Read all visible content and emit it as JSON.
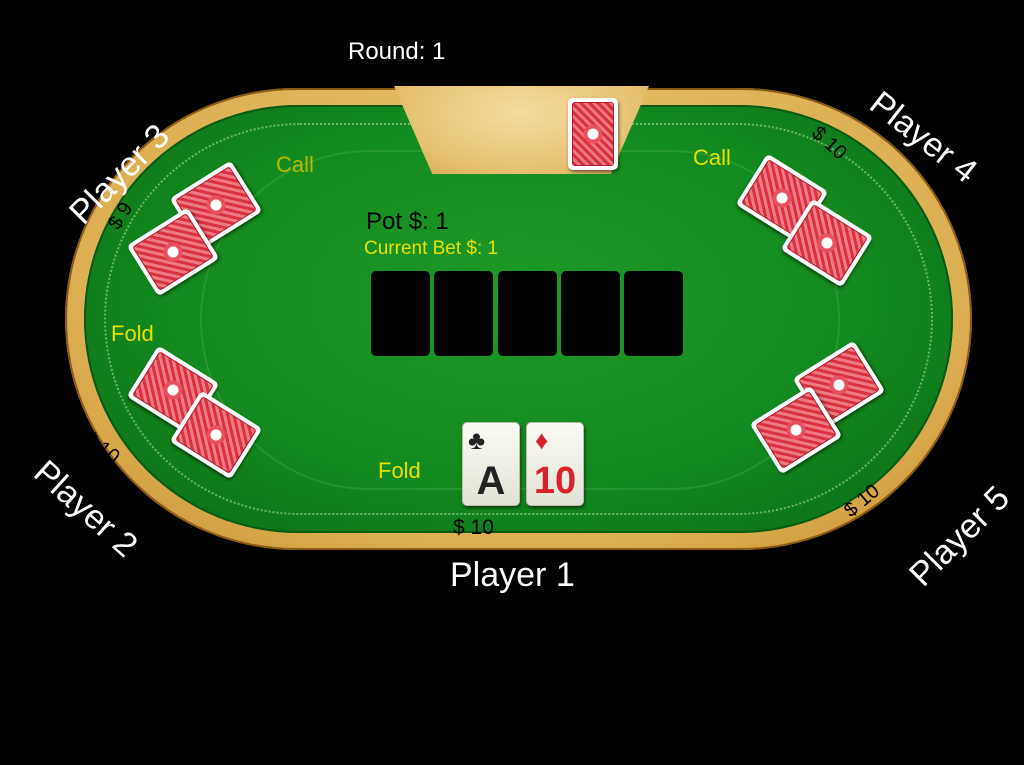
{
  "round_label": "Round: 1",
  "pot_label": "Pot $: 1",
  "current_bet_label": "Current Bet $: 1",
  "players": {
    "p1": {
      "name": "Player 1",
      "money": "$ 10",
      "action": "Fold"
    },
    "p2": {
      "name": "Player 2",
      "money": "$ 10",
      "action": "Fold"
    },
    "p3": {
      "name": "Player 3",
      "money": "$ 9",
      "action": "Call"
    },
    "p4": {
      "name": "Player 4",
      "money": "$ 10",
      "action": "Call"
    },
    "p5": {
      "name": "Player 5",
      "money": "$ 10",
      "action": ""
    }
  },
  "hand": [
    {
      "rank": "A",
      "suit": "♣",
      "color": "#222222"
    },
    {
      "rank": "10",
      "suit": "♦",
      "color": "#d8212b"
    }
  ],
  "community_slots": 5,
  "colors": {
    "felt": "#138a1f",
    "rail": "#dcae52",
    "action_text": "#e8e000",
    "card_back": "#d8313f"
  }
}
